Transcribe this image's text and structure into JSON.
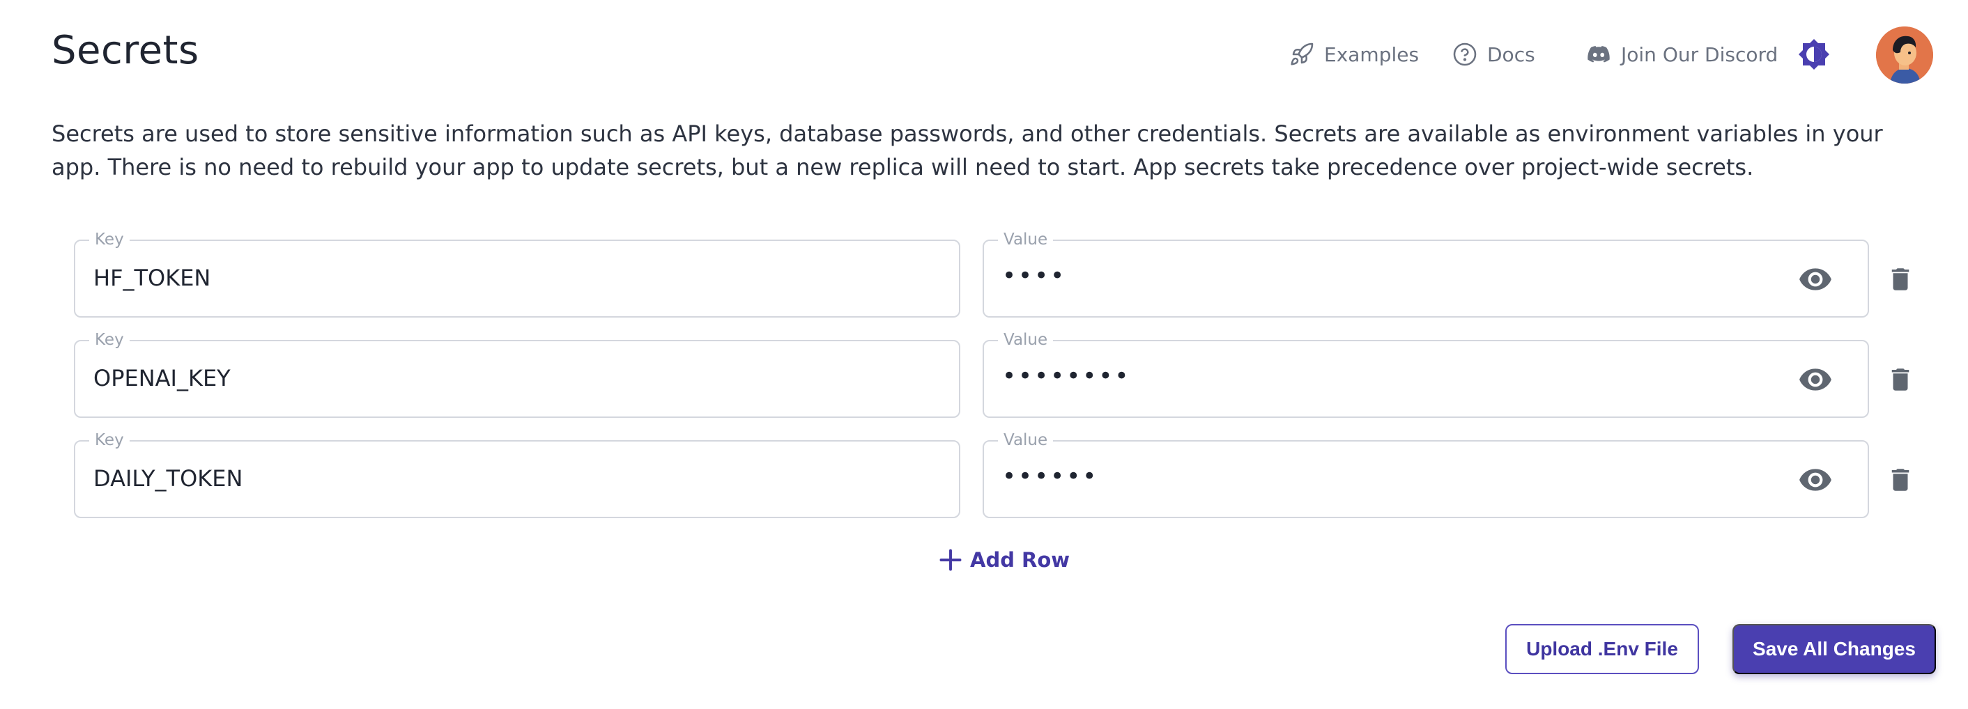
{
  "page": {
    "title": "Secrets",
    "description": "Secrets are used to store sensitive information such as API keys, database passwords, and other credentials. Secrets are available as environment variables in your app. There is no need to rebuild your app to update secrets, but a new replica will need to start. App secrets take precedence over project-wide secrets."
  },
  "nav": {
    "examples": {
      "label": "Examples",
      "icon": "rocket-icon"
    },
    "docs": {
      "label": "Docs",
      "icon": "question-circle-icon"
    },
    "discord": {
      "label": "Join Our Discord",
      "icon": "discord-icon"
    },
    "theme_toggle_icon": "half-moon-icon"
  },
  "secrets": {
    "key_label": "Key",
    "value_label": "Value",
    "rows": [
      {
        "key": "HF_TOKEN",
        "masked_value": "••••"
      },
      {
        "key": "OPENAI_KEY",
        "masked_value": "••••••••"
      },
      {
        "key": "DAILY_TOKEN",
        "masked_value": "••••••"
      }
    ]
  },
  "actions": {
    "add_row": "Add Row",
    "upload_env": "Upload .Env File",
    "save_all": "Save All Changes"
  },
  "colors": {
    "accent": "#4a3fb0",
    "border": "#d4d7de",
    "muted_text": "#6b7280",
    "icon_gray": "#5f6670"
  }
}
